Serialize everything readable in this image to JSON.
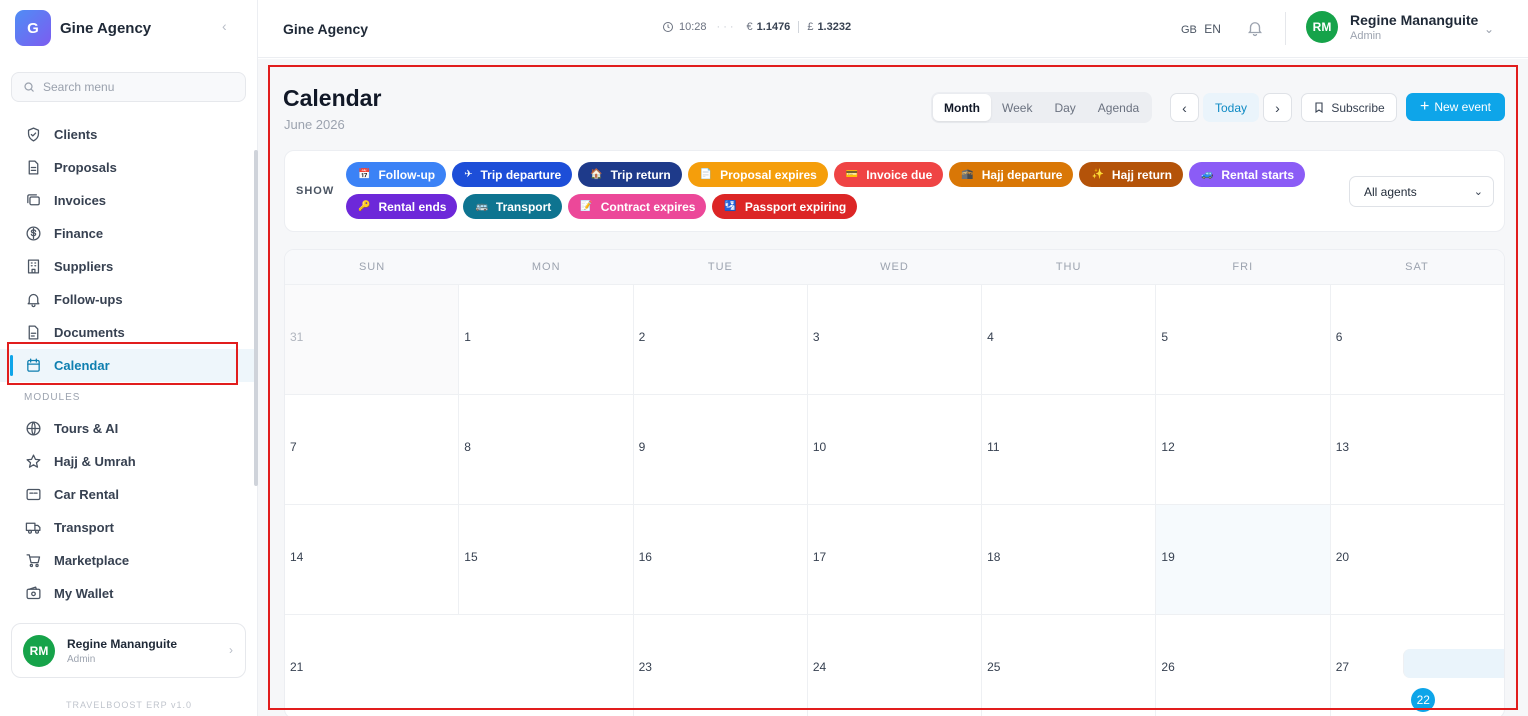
{
  "brand": {
    "logo_letter": "G",
    "name": "Gine Agency"
  },
  "search": {
    "placeholder": "Search menu"
  },
  "menu": [
    {
      "label": "Clients",
      "icon": "shield-icon"
    },
    {
      "label": "Proposals",
      "icon": "document-icon"
    },
    {
      "label": "Invoices",
      "icon": "invoice-icon"
    },
    {
      "label": "Finance",
      "icon": "dollar-circle-icon"
    },
    {
      "label": "Suppliers",
      "icon": "building-icon"
    },
    {
      "label": "Follow-ups",
      "icon": "bell-icon"
    },
    {
      "label": "Documents",
      "icon": "file-icon"
    },
    {
      "label": "Calendar",
      "icon": "calendar-icon",
      "active": true
    }
  ],
  "modules_label": "MODULES",
  "modules": [
    {
      "label": "Tours & AI",
      "icon": "globe-icon"
    },
    {
      "label": "Hajj & Umrah",
      "icon": "star-icon"
    },
    {
      "label": "Car Rental",
      "icon": "car-card-icon"
    },
    {
      "label": "Transport",
      "icon": "truck-icon"
    },
    {
      "label": "Marketplace",
      "icon": "cart-icon"
    },
    {
      "label": "My Wallet",
      "icon": "wallet-icon"
    }
  ],
  "user": {
    "initials": "RM",
    "name": "Regine Mananguite",
    "role": "Admin"
  },
  "version": "TRAVELBOOST ERP v1.0",
  "topbar": {
    "title": "Gine Agency",
    "time": "10:28",
    "eur_symbol": "€",
    "eur_rate": "1.1476",
    "gbp_symbol": "£",
    "gbp_rate": "1.3232",
    "lang_flag": "GB",
    "lang": "EN"
  },
  "calendar": {
    "title": "Calendar",
    "subtitle": "June 2026",
    "views": [
      "Month",
      "Week",
      "Day",
      "Agenda"
    ],
    "active_view": "Month",
    "today_label": "Today",
    "subscribe_label": "Subscribe",
    "new_event_label": "New event",
    "show_label": "SHOW",
    "agent_filter": "All agents",
    "filters": [
      {
        "label": "Follow-up",
        "emoji": "📅",
        "color": "#3b82f6"
      },
      {
        "label": "Trip departure",
        "emoji": "✈",
        "color": "#1d4ed8"
      },
      {
        "label": "Trip return",
        "emoji": "🏠",
        "color": "#1e3a8a"
      },
      {
        "label": "Proposal expires",
        "emoji": "📄",
        "color": "#f59e0b"
      },
      {
        "label": "Invoice due",
        "emoji": "💳",
        "color": "#ef4444"
      },
      {
        "label": "Hajj departure",
        "emoji": "🕋",
        "color": "#d97706"
      },
      {
        "label": "Hajj return",
        "emoji": "✨",
        "color": "#b45309"
      },
      {
        "label": "Rental starts",
        "emoji": "🚙",
        "color": "#8b5cf6"
      },
      {
        "label": "Rental ends",
        "emoji": "🔑",
        "color": "#6d28d9"
      },
      {
        "label": "Transport",
        "emoji": "🚌",
        "color": "#0e7490"
      },
      {
        "label": "Contract expires",
        "emoji": "📝",
        "color": "#ec4899"
      },
      {
        "label": "Passport expiring",
        "emoji": "🛂",
        "color": "#dc2626"
      }
    ],
    "weekdays": [
      "SUN",
      "MON",
      "TUE",
      "WED",
      "THU",
      "FRI",
      "SAT"
    ],
    "weeks": [
      [
        {
          "d": "31",
          "out": true
        },
        {
          "d": "1"
        },
        {
          "d": "2"
        },
        {
          "d": "3"
        },
        {
          "d": "4"
        },
        {
          "d": "5"
        },
        {
          "d": "6"
        }
      ],
      [
        {
          "d": "7"
        },
        {
          "d": "8"
        },
        {
          "d": "9"
        },
        {
          "d": "10"
        },
        {
          "d": "11"
        },
        {
          "d": "12"
        },
        {
          "d": "13"
        }
      ],
      [
        {
          "d": "14"
        },
        {
          "d": "15"
        },
        {
          "d": "16"
        },
        {
          "d": "17"
        },
        {
          "d": "18"
        },
        {
          "d": "19",
          "hl": true
        },
        {
          "d": "20"
        }
      ],
      [
        {
          "d": "21"
        },
        {
          "d": "22",
          "today": true
        },
        {
          "d": "23"
        },
        {
          "d": "24"
        },
        {
          "d": "25"
        },
        {
          "d": "26"
        },
        {
          "d": "27"
        }
      ]
    ]
  }
}
